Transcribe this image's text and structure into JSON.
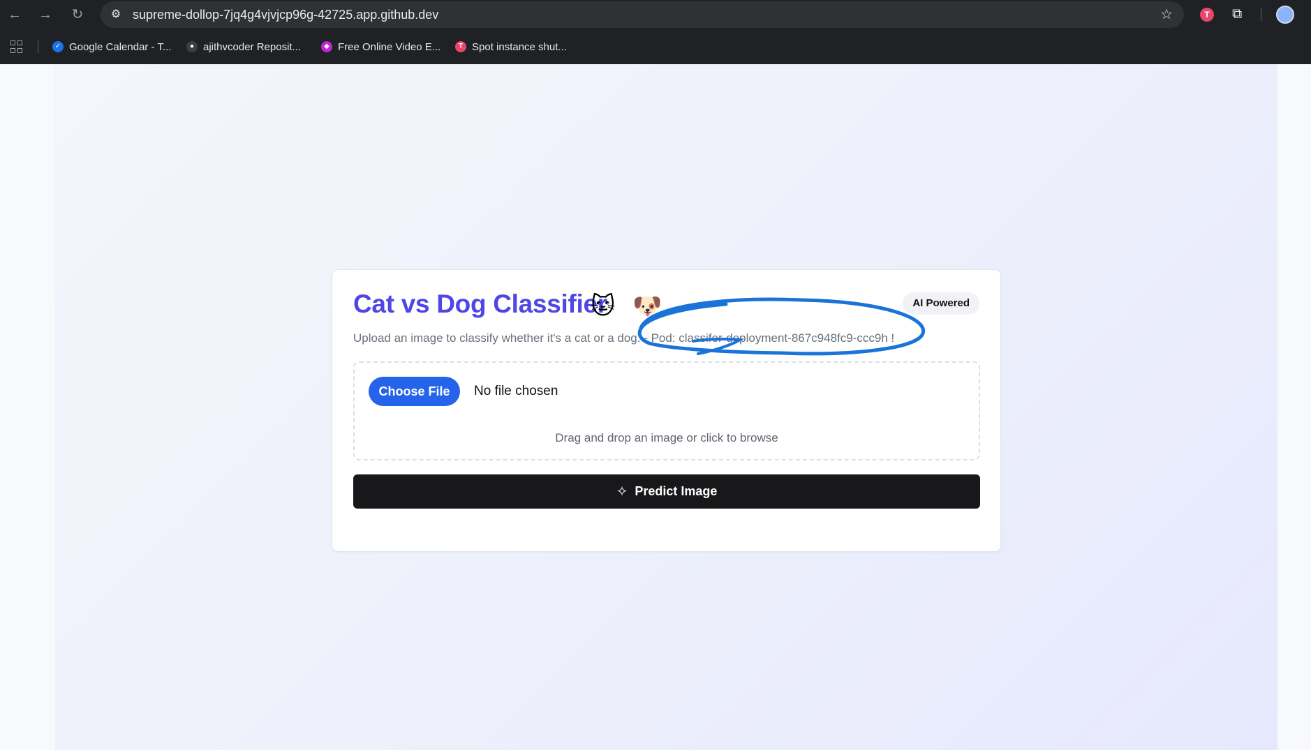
{
  "browser": {
    "url": "supreme-dollop-7jq4g4vjvjcp96g-42725.app.github.dev",
    "ext_badge_letter": "T",
    "bookmarks": [
      {
        "label": "Google Calendar - T...",
        "icon": "calendar-icon",
        "color": "#1a73e8"
      },
      {
        "label": "ajithvcoder Reposit...",
        "icon": "github-icon",
        "color": "#3c4043"
      },
      {
        "label": "Free Online Video E...",
        "icon": "video-editor-icon",
        "color": "#c026d3"
      },
      {
        "label": "Spot instance shut...",
        "icon": "t-icon",
        "color": "#e8466b",
        "letter": "T"
      }
    ]
  },
  "app": {
    "title": "Cat vs Dog Classifier",
    "cat_emoji": "🐱",
    "dog_emoji": "🐶",
    "badge": "AI Powered",
    "subtitle": "Upload an image to classify whether it's a cat or a dog. - Pod: classifer-deployment-867c948fc9-ccc9h !",
    "choose_file": "Choose File",
    "no_file": "No file chosen",
    "drag_hint": "Drag and drop an image or click to browse",
    "predict": "Predict Image",
    "accent": "#4f46e5",
    "button_blue": "#2563eb",
    "annotation_color": "#1a73d8"
  }
}
